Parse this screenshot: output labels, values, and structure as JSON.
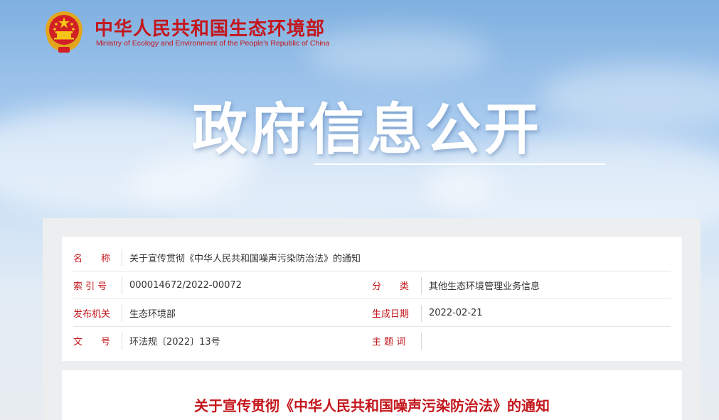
{
  "header": {
    "ministry_cn": "中华人民共和国生态环境部",
    "ministry_en": "Ministry of Ecology and Environment of the People's Republic of China",
    "emblem_icon": "national-emblem-icon",
    "banner_title": "政府信息公开"
  },
  "info": {
    "name_label": "名　　称",
    "name_value": "关于宣传贯彻《中华人民共和国噪声污染防治法》的通知",
    "index_label": "索 引 号",
    "index_value": "000014672/2022-00072",
    "category_label": "分　　类",
    "category_value": "其他生态环境管理业务信息",
    "issuer_label": "发布机关",
    "issuer_value": "生态环境部",
    "date_label": "生成日期",
    "date_value": "2022-02-21",
    "docno_label": "文　　号",
    "docno_value": "环法规〔2022〕13号",
    "keywords_label": "主 题 词",
    "keywords_value": ""
  },
  "document": {
    "title": "关于宣传贯彻《中华人民共和国噪声污染防治法》的通知"
  },
  "colors": {
    "accent_red": "#c4161c",
    "text": "#333333"
  }
}
